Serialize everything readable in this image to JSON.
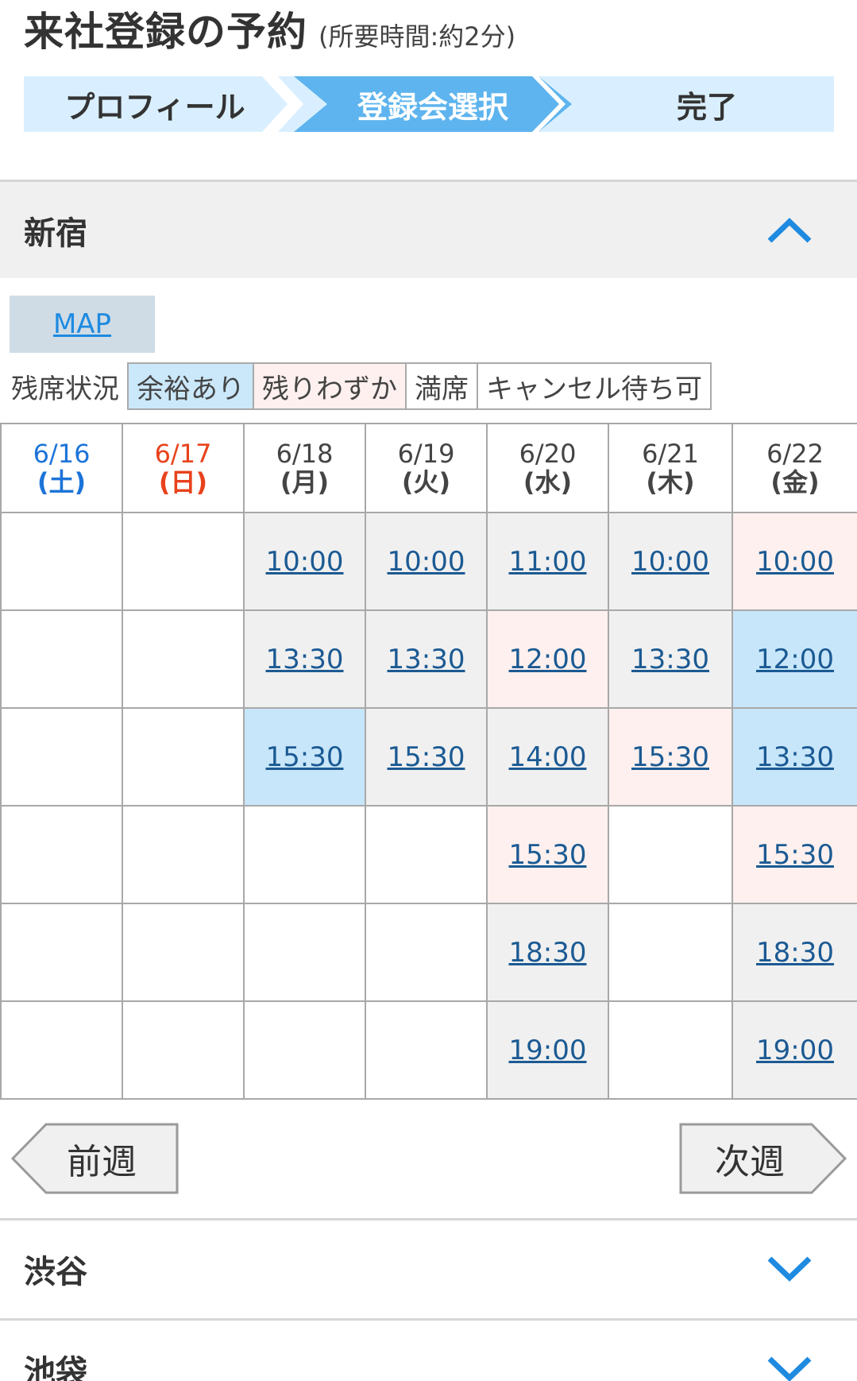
{
  "header": {
    "title": "来社登録の予約",
    "subtitle": "(所要時間:約2分)"
  },
  "steps": [
    {
      "label": "プロフィール",
      "active": false
    },
    {
      "label": "登録会選択",
      "active": true
    },
    {
      "label": "完了",
      "active": false
    }
  ],
  "sections": [
    {
      "name": "新宿",
      "expanded": true,
      "icon": "chevron-up-icon"
    },
    {
      "name": "渋谷",
      "expanded": false,
      "icon": "chevron-down-icon"
    },
    {
      "name": "池袋",
      "expanded": false,
      "icon": "chevron-down-icon"
    }
  ],
  "map_button": {
    "label": "MAP"
  },
  "legend": {
    "label": "残席状況",
    "items": [
      {
        "label": "余裕あり",
        "color": "#cbe8fb"
      },
      {
        "label": "残りわずか",
        "color": "#fdf0ee"
      },
      {
        "label": "満席",
        "color": "#ffffff"
      },
      {
        "label": "キャンセル待ち可",
        "color": "#ffffff"
      }
    ]
  },
  "calendar": {
    "days": [
      {
        "date": "6/16",
        "dow": "(土)",
        "type": "sat"
      },
      {
        "date": "6/17",
        "dow": "(日)",
        "type": "sun"
      },
      {
        "date": "6/18",
        "dow": "(月)",
        "type": "weekday"
      },
      {
        "date": "6/19",
        "dow": "(火)",
        "type": "weekday"
      },
      {
        "date": "6/20",
        "dow": "(水)",
        "type": "weekday"
      },
      {
        "date": "6/21",
        "dow": "(木)",
        "type": "weekday"
      },
      {
        "date": "6/22",
        "dow": "(金)",
        "type": "weekday"
      }
    ],
    "rows": [
      [
        "",
        "",
        "10:00",
        "10:00",
        "11:00",
        "10:00",
        "10:00"
      ],
      [
        "",
        "",
        "13:30",
        "13:30",
        "12:00",
        "13:30",
        "12:00"
      ],
      [
        "",
        "",
        "15:30",
        "15:30",
        "14:00",
        "15:30",
        "13:30"
      ],
      [
        "",
        "",
        "",
        "",
        "15:30",
        "",
        "15:30"
      ],
      [
        "",
        "",
        "",
        "",
        "18:30",
        "",
        "18:30"
      ],
      [
        "",
        "",
        "",
        "",
        "19:00",
        "",
        "19:00"
      ]
    ],
    "status": [
      [
        "",
        "",
        "gray",
        "gray",
        "gray",
        "gray",
        "pink"
      ],
      [
        "",
        "",
        "gray",
        "gray",
        "pink",
        "gray",
        "blue"
      ],
      [
        "",
        "",
        "blue",
        "gray",
        "gray",
        "pink",
        "blue"
      ],
      [
        "",
        "",
        "",
        "",
        "pink",
        "",
        "pink"
      ],
      [
        "",
        "",
        "",
        "",
        "gray",
        "",
        "gray"
      ],
      [
        "",
        "",
        "",
        "",
        "gray",
        "",
        "gray"
      ]
    ]
  },
  "week_nav": {
    "prev_label": "前週",
    "next_label": "次週"
  },
  "colors": {
    "accent": "#5eb4ee",
    "step_bg": "#d9efff",
    "link": "#1b5a93",
    "chevron": "#1e8ae0",
    "saturday": "#1c74d8",
    "sunday": "#e8421c"
  }
}
